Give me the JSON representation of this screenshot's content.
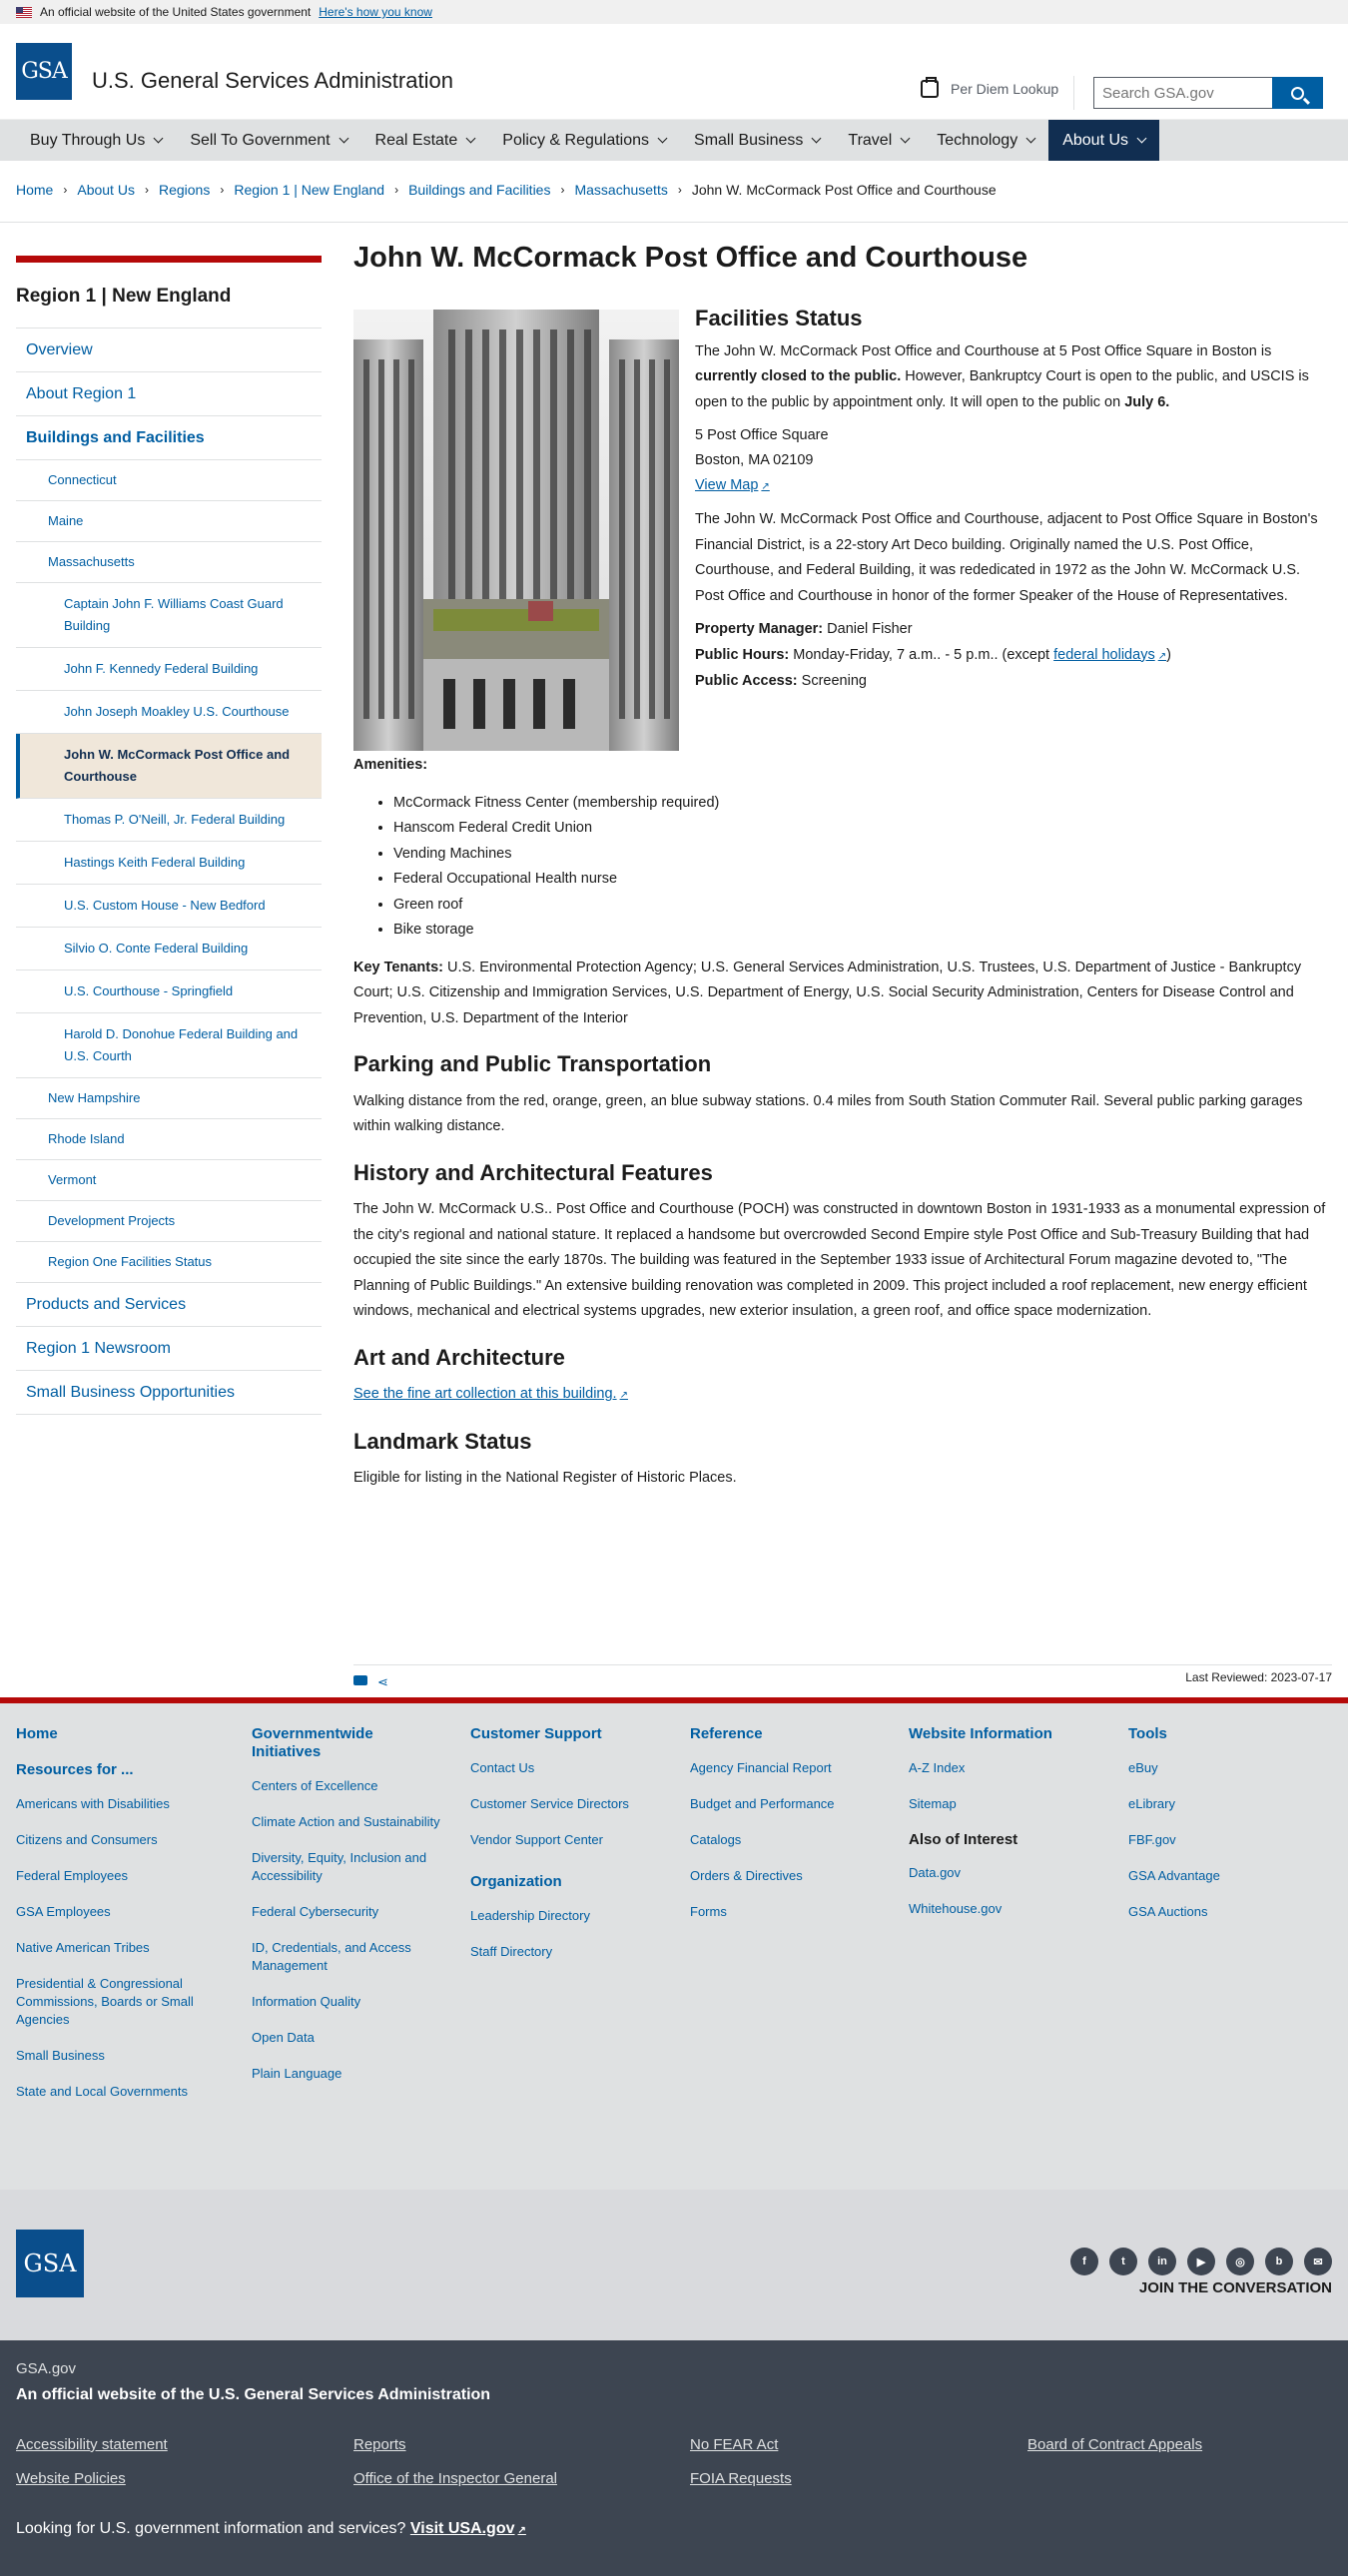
{
  "banner": {
    "text": "An official website of the United States government",
    "link": "Here's how you know"
  },
  "header": {
    "logo": "GSA",
    "title": "U.S. General Services Administration",
    "per_diem": "Per Diem Lookup",
    "search_placeholder": "Search GSA.gov"
  },
  "nav": [
    "Buy Through Us",
    "Sell To Government",
    "Real Estate",
    "Policy & Regulations",
    "Small Business",
    "Travel",
    "Technology",
    "About Us"
  ],
  "breadcrumb": [
    "Home",
    "About Us",
    "Regions",
    "Region 1 | New England",
    "Buildings and Facilities",
    "Massachusetts",
    "John W. McCormack Post Office and Courthouse"
  ],
  "sidebar": {
    "title": "Region 1 | New England",
    "items": [
      {
        "label": "Overview",
        "level": 1
      },
      {
        "label": "About Region 1",
        "level": 1
      },
      {
        "label": "Buildings and Facilities",
        "level": 1
      },
      {
        "label": "Connecticut",
        "level": 2
      },
      {
        "label": "Maine",
        "level": 2
      },
      {
        "label": "Massachusetts",
        "level": 2
      },
      {
        "label": "Captain John F. Williams Coast Guard Building",
        "level": 3
      },
      {
        "label": "John F. Kennedy Federal Building",
        "level": 3
      },
      {
        "label": "John Joseph Moakley U.S. Courthouse",
        "level": 3
      },
      {
        "label": "John W. McCormack Post Office and Courthouse",
        "level": 3
      },
      {
        "label": "Thomas P. O'Neill, Jr. Federal Building",
        "level": 3
      },
      {
        "label": "Hastings Keith Federal Building",
        "level": 3
      },
      {
        "label": "U.S. Custom House - New Bedford",
        "level": 3
      },
      {
        "label": "Silvio O. Conte Federal Building",
        "level": 3
      },
      {
        "label": "U.S. Courthouse - Springfield",
        "level": 3
      },
      {
        "label": "Harold D. Donohue Federal Building and U.S. Courth",
        "level": 3
      },
      {
        "label": "New Hampshire",
        "level": 2
      },
      {
        "label": "Rhode Island",
        "level": 2
      },
      {
        "label": "Vermont",
        "level": 2
      },
      {
        "label": "Development Projects",
        "level": 2
      },
      {
        "label": "Region One Facilities Status",
        "level": 2
      },
      {
        "label": "Products and Services",
        "level": 1
      },
      {
        "label": "Region 1 Newsroom",
        "level": 1
      },
      {
        "label": "Small Business Opportunities",
        "level": 1
      }
    ]
  },
  "main": {
    "title": "John W. McCormack Post Office and Courthouse",
    "facilities_heading": "Facilities Status",
    "status_1": "The John W. McCormack Post Office and Courthouse at 5 Post Office Square in Boston is ",
    "status_bold": "currently closed to the public.",
    "status_2": " However, Bankruptcy Court is open to the public, and USCIS is open to the public by appointment only. It will open to the public on ",
    "status_date": "July 6.",
    "address_1": "5 Post Office Square",
    "address_2": "Boston, MA 02109",
    "view_map": "View Map",
    "description": "The John W. McCormack Post Office and Courthouse, adjacent to Post Office Square in Boston's Financial District, is a 22-story Art Deco building. Originally named the U.S. Post Office, Courthouse, and Federal Building, it was rededicated in 1972 as the John W. McCormack U.S. Post Office and Courthouse in honor of the former Speaker of the House of Representatives.",
    "pm_label": "Property Manager:",
    "pm_value": " Daniel Fisher",
    "hours_label": "Public Hours:",
    "hours_value": " Monday-Friday, 7 a.m.. - 5 p.m.. (except ",
    "hours_link": "federal holidays",
    "hours_end": ")",
    "access_label": "Public Access:",
    "access_value": " Screening",
    "amenities_label": "Amenities:",
    "amenities": [
      "McCormack Fitness Center (membership required)",
      "Hanscom Federal Credit Union",
      "Vending Machines",
      "Federal Occupational Health nurse",
      "Green roof",
      "Bike storage"
    ],
    "tenants_label": "Key Tenants:",
    "tenants_value": " U.S. Environmental Protection Agency; U.S. General Services Administration, U.S. Trustees, U.S. Department of Justice - Bankruptcy Court; U.S. Citizenship and Immigration Services, U.S. Department of Energy, U.S. Social Security Administration, Centers for Disease Control and Prevention, U.S. Department of the Interior",
    "parking_heading": "Parking and Public Transportation",
    "parking_text": "Walking distance from the red, orange, green, an blue subway stations. 0.4 miles from South Station Commuter Rail. Several public parking garages within walking distance.",
    "history_heading": "History and Architectural Features",
    "history_text": "The John W. McCormack U.S.. Post Office and Courthouse (POCH) was constructed in downtown Boston in 1931-1933 as a monumental expression of the city's regional and national stature. It replaced a handsome but overcrowded Second Empire style Post Office and Sub-Treasury Building that had occupied the site since the early 1870s. The building was featured in the September 1933 issue of Architectural Forum magazine devoted to, \"The Planning of Public Buildings.\" An extensive building renovation was completed in 2009. This project included a roof replacement, new energy efficient windows, mechanical and electrical systems upgrades, new exterior insulation, a green roof, and office space modernization.",
    "art_heading": "Art and Architecture",
    "art_link": "See the fine art collection at this building.",
    "landmark_heading": "Landmark Status",
    "landmark_text": "Eligible for listing in the National Register of Historic Places.",
    "last_reviewed": "Last Reviewed: 2023-07-17"
  },
  "footer": {
    "home": "Home",
    "resources_heading": "Resources for ...",
    "resources": [
      "Americans with Disabilities",
      "Citizens and Consumers",
      "Federal Employees",
      "GSA Employees",
      "Native American Tribes",
      "Presidential & Congressional Commissions, Boards or Small Agencies",
      "Small Business",
      "State and Local Governments"
    ],
    "govwide_heading": "Governmentwide Initiatives",
    "govwide": [
      "Centers of Excellence",
      "Climate Action and Sustainability",
      "Diversity, Equity, Inclusion and Accessibility",
      "Federal Cybersecurity",
      "ID, Credentials, and Access Management",
      "Information Quality",
      "Open Data",
      "Plain Language"
    ],
    "support_heading": "Customer Support",
    "support": [
      "Contact Us",
      "Customer Service Directors",
      "Vendor Support Center"
    ],
    "org_heading": "Organization",
    "org": [
      "Leadership Directory",
      "Staff Directory"
    ],
    "reference_heading": "Reference",
    "reference": [
      "Agency Financial Report",
      "Budget and Performance",
      "Catalogs",
      "Orders & Directives",
      "Forms"
    ],
    "webinfo_heading": "Website Information",
    "webinfo": [
      "A-Z Index",
      "Sitemap"
    ],
    "interest_heading": "Also of Interest",
    "interest": [
      "Data.gov",
      "Whitehouse.gov"
    ],
    "tools_heading": "Tools",
    "tools": [
      "eBuy",
      "eLibrary",
      "FBF.gov",
      "GSA Advantage",
      "GSA Auctions"
    ],
    "join": "JOIN THE CONVERSATION",
    "logo": "GSA",
    "social": [
      {
        "icon": "facebook-icon",
        "glyph": "f"
      },
      {
        "icon": "twitter-icon",
        "glyph": "t"
      },
      {
        "icon": "linkedin-icon",
        "glyph": "in"
      },
      {
        "icon": "youtube-icon",
        "glyph": "▶"
      },
      {
        "icon": "instagram-icon",
        "glyph": "◎"
      },
      {
        "icon": "blog-icon",
        "glyph": "b"
      },
      {
        "icon": "email-icon",
        "glyph": "✉"
      }
    ],
    "site": "GSA.gov",
    "official": "An official website of the U.S. General Services Administration",
    "bottom_links": [
      "Accessibility statement",
      "Reports",
      "No FEAR Act",
      "Board of Contract Appeals",
      "Website Policies",
      "Office of the Inspector General",
      "FOIA Requests"
    ],
    "usa_text": "Looking for U.S. government information and services? ",
    "usa_link": "Visit USA.gov"
  }
}
